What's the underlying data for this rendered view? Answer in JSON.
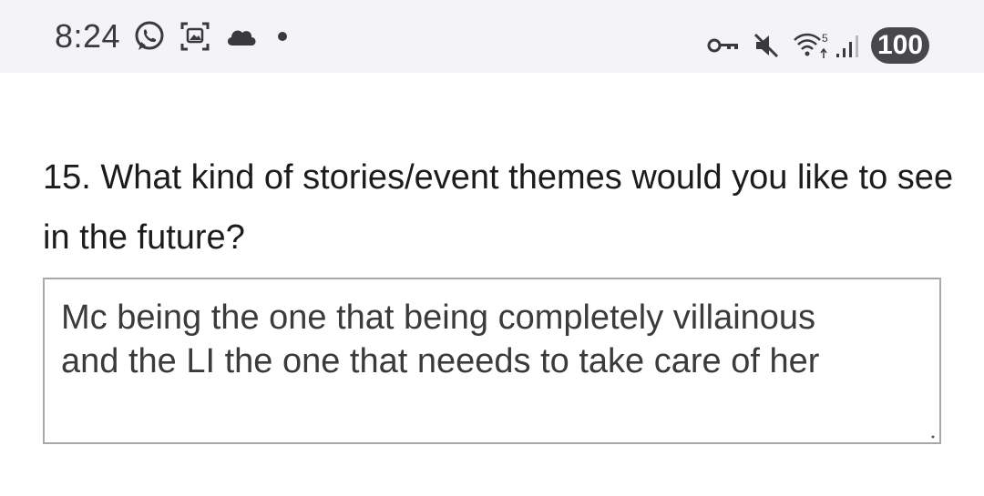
{
  "status_bar": {
    "time": "8:24",
    "battery": "100",
    "left_icons": [
      "whatsapp-icon",
      "screenshot-icon",
      "cloud-icon",
      "notification-dot-icon"
    ],
    "right_icons": [
      "vpn-key-icon",
      "mute-icon",
      "wifi-icon",
      "signal-icon"
    ],
    "wifi_label": "5"
  },
  "form": {
    "question": "15. What kind of stories/event themes would you like to see in the future?",
    "answer": "Mc being the one that being completely villainous\nand the LI the one that neeeds to take care of her"
  }
}
